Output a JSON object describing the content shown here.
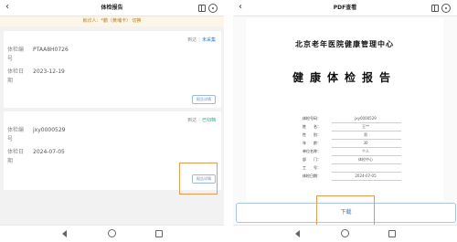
{
  "left": {
    "title": "体检报告",
    "patient_bar": "就诊人：*鹏（黄埔卡）",
    "patient_switch": "切换",
    "cards": [
      {
        "actions": {
          "action": "到达",
          "status": "未采集"
        },
        "number_label": "体检编号",
        "number_value": "PTAA8H0726",
        "date_label": "体检日期",
        "date_value": "2023-12-19",
        "view_label": "报告详情"
      },
      {
        "actions": {
          "action": "到达",
          "status": "已归档"
        },
        "number_label": "体检编号",
        "number_value": "jxy0000529",
        "date_label": "体检日期",
        "date_value": "2024-07-05",
        "view_label": "报告详情"
      }
    ]
  },
  "right": {
    "title": "PDF查看",
    "pdf": {
      "org": "北京老年医院健康管理中心",
      "title": "健康体检报告",
      "rows": [
        {
          "k": "体检号码：",
          "v": "jxy0000529"
        },
        {
          "k": "姓　　名：",
          "v": "王**"
        },
        {
          "k": "性　　别：",
          "v": "男"
        },
        {
          "k": "年　　龄：",
          "v": "30"
        },
        {
          "k": "单位名称：",
          "v": "个人"
        },
        {
          "k": "部　　门：",
          "v": "体检中心"
        },
        {
          "k": "工　　号：",
          "v": ""
        },
        {
          "k": "体检日期：",
          "v": "2024-07-05"
        }
      ]
    },
    "download_label": "下载"
  },
  "icons": {
    "back": "back-chevron-icon",
    "window": "split-window-icon",
    "more": "more-options-icon",
    "nav_back": "nav-back-icon",
    "nav_home": "nav-home-icon",
    "nav_recent": "nav-recent-icon"
  },
  "colors": {
    "accent_blue": "#3f78b8",
    "highlight_orange": "#e69a52",
    "status_green": "#2b9d74"
  }
}
